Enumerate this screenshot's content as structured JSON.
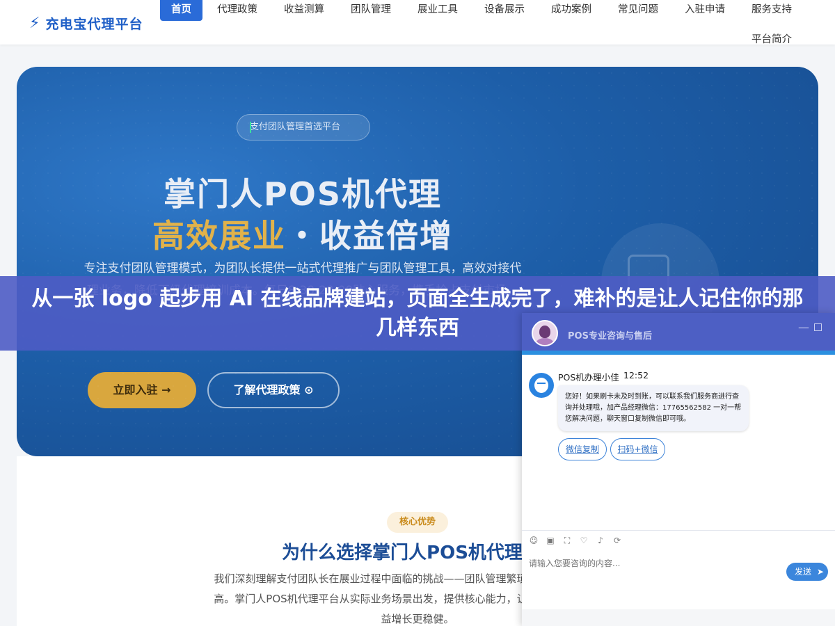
{
  "header": {
    "logo_icon": "lightning-bolt",
    "logo_text": "充电宝代理平台",
    "nav": [
      "首页",
      "代理政策",
      "收益测算",
      "团队管理",
      "展业工具",
      "设备展示",
      "成功案例",
      "常见问题",
      "入驻申请",
      "服务支持",
      "平台简介"
    ],
    "active_index": 0
  },
  "hero": {
    "badge": "支付团队管理首选平台",
    "title_line1": "掌门人POS机代理",
    "title_line2_highlight": "高效展业",
    "title_line2_rest": "・收益倍增",
    "description": "专注支付团队管理模式，为团队长提供一站式代理推广与团队管理工具，高效对接代理业务，降低下级代理培训成本。每日8:30-20:00贴心服务，携手抢占支付市场。",
    "btn_join": "立即入驻",
    "btn_policy": "了解代理政策",
    "icon_arrow_right": "arrow-right-icon",
    "icon_circle_arrow": "circle-arrow-icon"
  },
  "section": {
    "tag": "核心优势",
    "title": "为什么选择掌门人POS机代理平台",
    "description": "我们深刻理解支付团队长在展业过程中面临的挑战——团队管理繁琐、下级代理培训成本高。掌门人POS机代理平台从实际业务场景出发，提供核心能力，让团队管理更高效、收益增长更稳健。"
  },
  "banner": {
    "text": "从一张 logo 起步用 AI 在线品牌建站，页面全生成完了，难补的是让人记住你的那几样东西"
  },
  "chat": {
    "title": "POS专业咨询与售后",
    "agent_name": "POS机办理小佳",
    "time": "12:52",
    "message": "您好！如果刷卡未及时到账，可以联系我们服务商进行查询并处理哦，加产品经理微信：17765562582 一对一帮您解决问题，聊天窗口复制微信即可哦。",
    "quick_replies": [
      "微信复制",
      "扫码+微信"
    ],
    "input_placeholder": "请输入您要咨询的内容...",
    "send_label": "发送",
    "tools": [
      "emoji-icon",
      "image-icon",
      "screenshot-icon",
      "evaluate-icon",
      "voice-icon",
      "transfer-icon"
    ]
  },
  "colors": {
    "brand": "#1f5fc7",
    "nav_active": "#2a6bd8",
    "hero_bg": "#1d5ea8",
    "gold": "#e1b24a",
    "banner": "#4e5cc4",
    "chat_header": "#4d5fc4",
    "send": "#3b86dc"
  }
}
